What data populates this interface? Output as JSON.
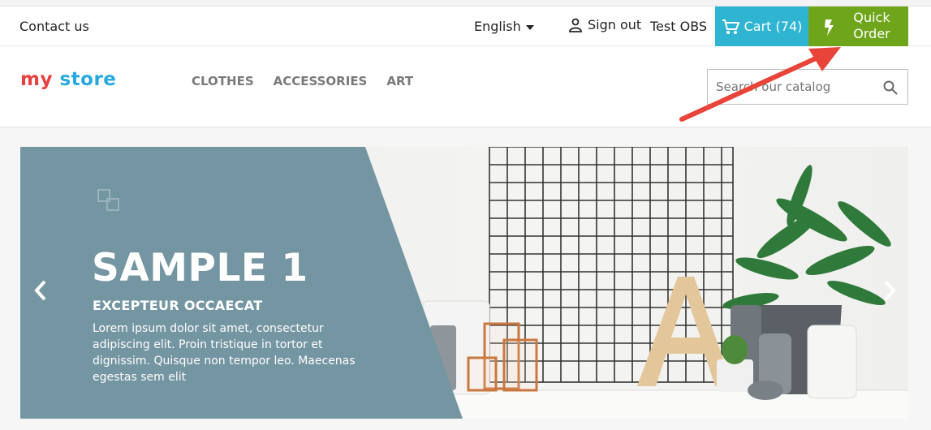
{
  "nav": {
    "contact_label": "Contact us",
    "language_label": "English",
    "signout_label": "Sign out",
    "username": "Test OBS",
    "cart_label": "Cart (74)",
    "quick_order_label": "Quick Order"
  },
  "header": {
    "logo": {
      "part1": "my",
      "part2": " store"
    },
    "menu": [
      "CLOTHES",
      "ACCESSORIES",
      "ART"
    ],
    "search_placeholder": "Search our catalog"
  },
  "slider": {
    "title": "SAMPLE 1",
    "subtitle": "EXCEPTEUR OCCAECAT",
    "description": "Lorem ipsum dolor sit amet, consectetur adipiscing elit. Proin tristique in tortor et dignissim. Quisque non tempor leo. Maecenas egestas sem elit"
  },
  "colors": {
    "cart_bg": "#2fb5d2",
    "quick_order_bg": "#6fa51b",
    "slide_panel": "#7495a2",
    "annotation_arrow": "#e8443a"
  },
  "icons": [
    "user-icon",
    "cart-icon",
    "bolt-icon",
    "search-icon",
    "chevron-left-icon",
    "chevron-right-icon",
    "slide-decor-icon"
  ]
}
